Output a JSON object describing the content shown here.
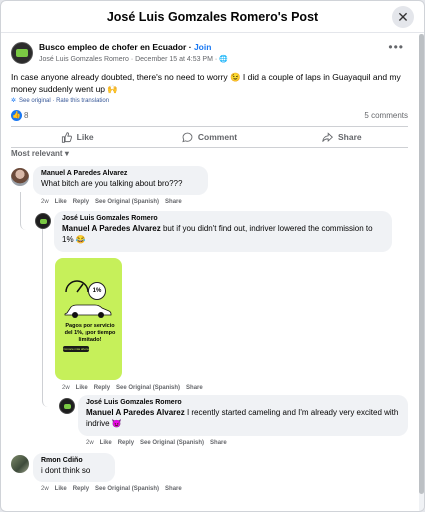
{
  "dialog": {
    "title": "José Luis Gomzales Romero's Post"
  },
  "post": {
    "group": "Busco empleo de chofer en Ecuador",
    "separator": " · ",
    "join": "Join",
    "author": "José Luis Gomzales Romero",
    "date": "December 15 at 4:53 PM",
    "text": "In case anyone already doubted, there's no need to worry 😉 I did a couple of laps in Guayaquil and my money suddenly went up 🙌",
    "see_original": "See original",
    "rate_translation": "Rate this translation",
    "likes": "8",
    "comments": "5 comments"
  },
  "actions": {
    "like": "Like",
    "comment": "Comment",
    "share": "Share"
  },
  "sort": {
    "label": "Most relevant"
  },
  "comment_actions": {
    "time": "2w",
    "like": "Like",
    "reply": "Reply",
    "see_original": "See Original (Spanish)",
    "share": "Share"
  },
  "comments": [
    {
      "name": "Manuel A Paredes Alvarez",
      "text": "What bitch are you talking about bro???"
    },
    {
      "name": "José Luis Gomzales Romero",
      "tag": "Manuel A Paredes Alvarez",
      "text": " but if you didn't find out, indriver lowered the commission to 1% 😂"
    },
    {
      "name": "José Luis Gomzales Romero",
      "tag": "Manuel A Paredes Alvarez",
      "text": " I recently started cameling and I'm already very excited with indrive 😈"
    },
    {
      "name": "Rmon Cdiño",
      "text": "i dont think so"
    }
  ],
  "promo": {
    "percent": "1%",
    "text": "Pagos por servicio del 1%, ¡por tiempo limitado!",
    "button": "Conoce más ahora"
  },
  "colors": {
    "accent": "#1877f2",
    "promo_bg": "#c6f05a",
    "bubble": "#f0f2f5",
    "muted": "#65676b"
  },
  "icons": [
    "close-icon",
    "more-icon",
    "globe-icon",
    "like-icon",
    "comment-icon",
    "share-icon",
    "chevron-down-icon",
    "gear-icon"
  ]
}
